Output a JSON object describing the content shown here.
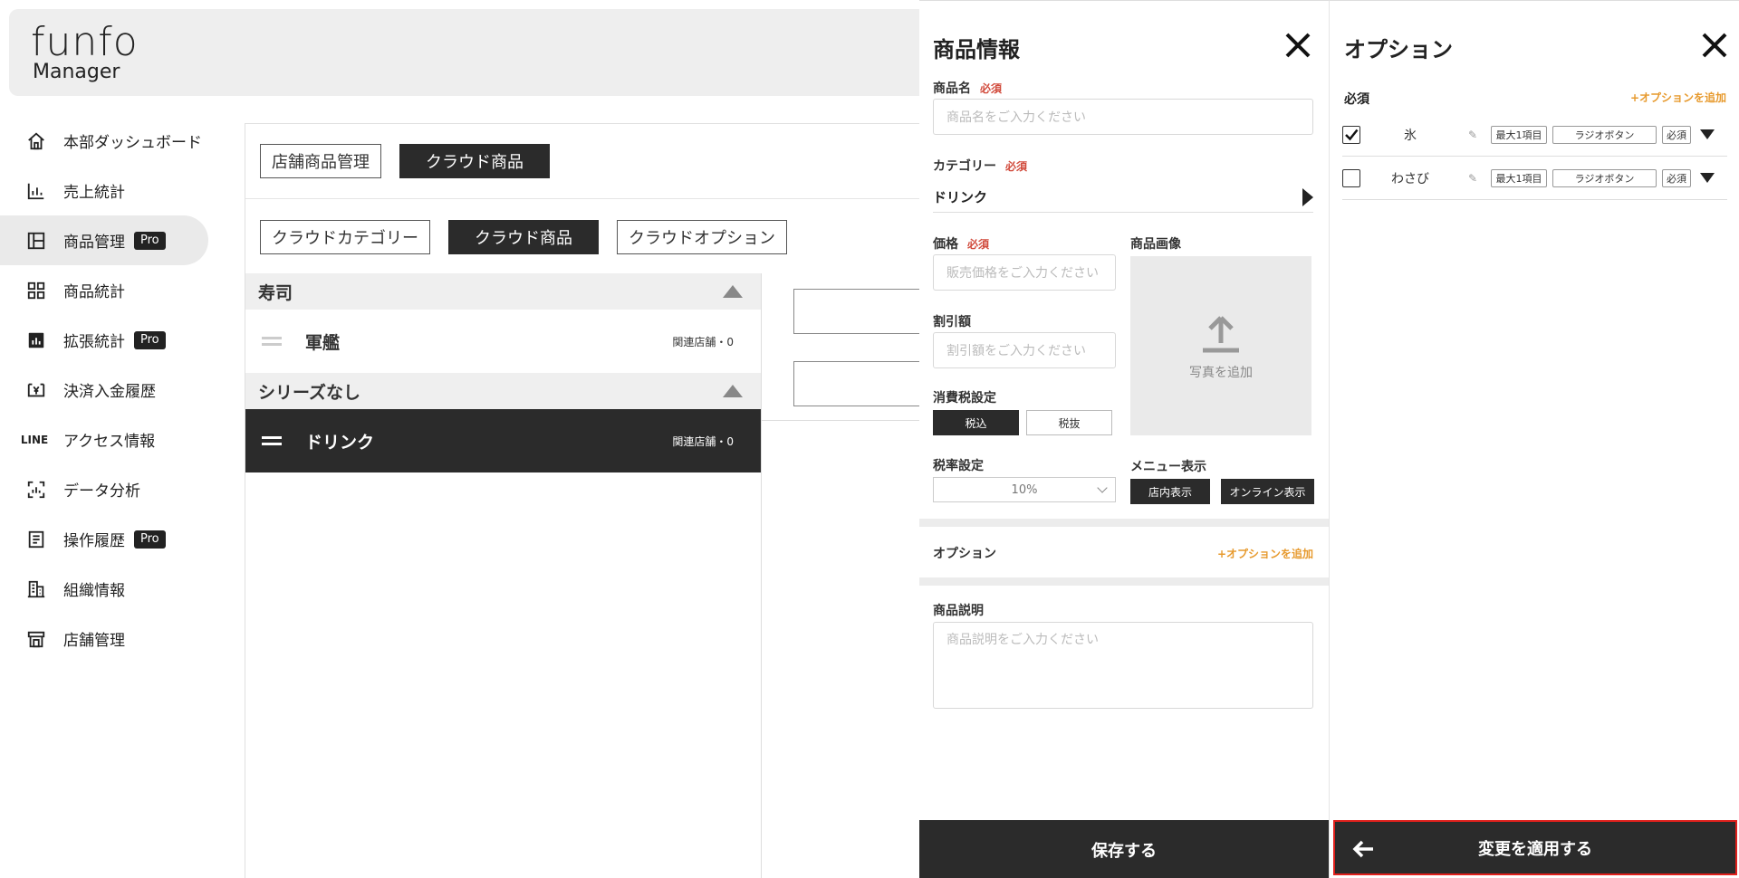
{
  "app": {
    "logo_line1": "funfo",
    "logo_line2": "Manager"
  },
  "sidebar": {
    "items": [
      {
        "label": "本部ダッシュボード",
        "icon": "home-icon",
        "pro": ""
      },
      {
        "label": "売上統計",
        "icon": "bar-chart-icon",
        "pro": ""
      },
      {
        "label": "商品管理",
        "icon": "layout-icon",
        "pro": "Pro"
      },
      {
        "label": "商品統計",
        "icon": "grid-icon",
        "pro": ""
      },
      {
        "label": "拡張統計",
        "icon": "chart-box-icon",
        "pro": "Pro"
      },
      {
        "label": "決済入金履歴",
        "icon": "money-icon",
        "pro": ""
      },
      {
        "label": "アクセス情報",
        "icon": "line-icon",
        "pro": "",
        "icon_text": "LINE"
      },
      {
        "label": "データ分析",
        "icon": "scan-icon",
        "pro": ""
      },
      {
        "label": "操作履歴",
        "icon": "list-icon",
        "pro": "Pro"
      },
      {
        "label": "組織情報",
        "icon": "building-icon",
        "pro": ""
      },
      {
        "label": "店舗管理",
        "icon": "store-icon",
        "pro": ""
      }
    ]
  },
  "main": {
    "top_tabs": [
      "店舗商品管理",
      "クラウド商品"
    ],
    "sub_tabs": [
      "クラウドカテゴリー",
      "クラウド商品",
      "クラウドオプション"
    ],
    "groups": [
      {
        "name": "寿司",
        "rows": [
          {
            "name": "軍艦",
            "meta": "関連店舗・0"
          }
        ]
      },
      {
        "name": "シリーズなし",
        "rows": [
          {
            "name": "ドリンク",
            "meta": "関連店舗・0"
          }
        ]
      }
    ]
  },
  "product_panel": {
    "title": "商品情報",
    "required": "必須",
    "name_label": "商品名",
    "name_placeholder": "商品名をご入力ください",
    "category_label": "カテゴリー",
    "category_value": "ドリンク",
    "price_label": "価格",
    "price_placeholder": "販売価格をご入力ください",
    "discount_label": "割引額",
    "discount_placeholder": "割引額をご入力ください",
    "tax_label": "消費税設定",
    "tax_options": [
      "税込",
      "税抜"
    ],
    "rate_label": "税率設定",
    "rate_value": "10%",
    "image_label": "商品画像",
    "image_add": "写真を追加",
    "menu_label": "メニュー表示",
    "menu_options": [
      "店内表示",
      "オンライン表示"
    ],
    "option_label": "オプション",
    "option_add": "+オプションを追加",
    "desc_label": "商品説明",
    "desc_placeholder": "商品説明をご入力ください",
    "save": "保存する"
  },
  "option_panel": {
    "title": "オプション",
    "required": "必須",
    "add": "+オプションを追加",
    "items": [
      {
        "name": "氷",
        "checked": true,
        "max": "最大1項目",
        "type": "ラジオボタン",
        "req": "必須"
      },
      {
        "name": "わさび",
        "checked": false,
        "max": "最大1項目",
        "type": "ラジオボタン",
        "req": "必須"
      }
    ],
    "apply": "変更を適用する"
  },
  "colors": {
    "dark": "#2b2b2b",
    "required_red": "#d14a3b",
    "accent_orange": "#e79a2e",
    "highlight_red": "#e0201c"
  }
}
